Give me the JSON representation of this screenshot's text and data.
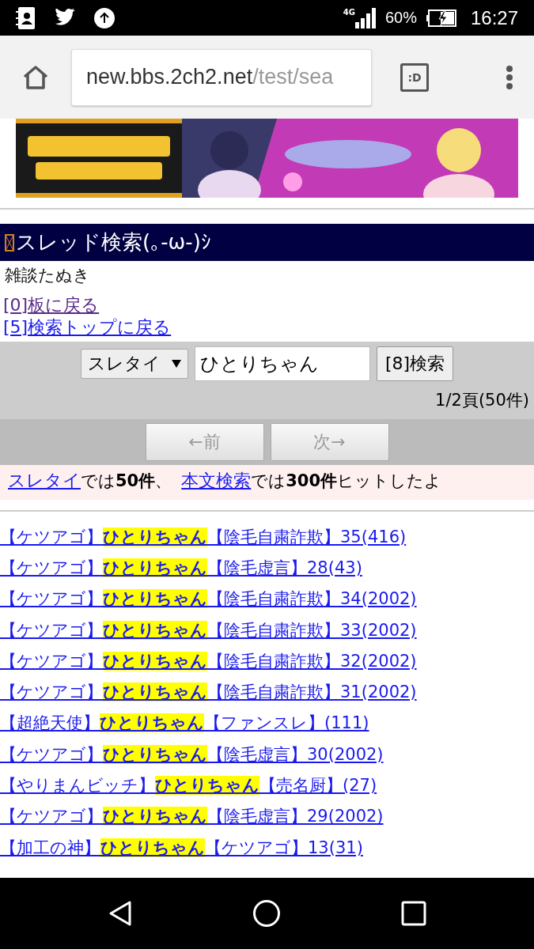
{
  "status_bar": {
    "network": "4G",
    "battery": "60%",
    "time": "16:27"
  },
  "browser": {
    "url_host": "new.bbs.2ch2.net",
    "url_path": "/test/sea",
    "tab_button": ":D"
  },
  "page": {
    "title": "スレッド検索(｡-ω-)ｼ",
    "board": "雑談たぬき",
    "nav_links": [
      {
        "label": "[0]板に戻る",
        "visited": true
      },
      {
        "label": "[5]検索トップに戻る",
        "visited": false
      }
    ]
  },
  "search": {
    "mode": "スレタイ",
    "query": "ひとりちゃん",
    "button": "[8]検索",
    "page_info": "1/2頁(50件)",
    "pager": [
      {
        "label": "←前",
        "disabled": true
      },
      {
        "label": "次→",
        "disabled": true
      }
    ]
  },
  "summary": [
    {
      "kind": "link",
      "text": "スレタイ"
    },
    {
      "kind": "text",
      "text": "では**50件**、"
    },
    {
      "kind": "link",
      "text": "本文検索"
    },
    {
      "kind": "text",
      "text": "では**300件**ヒットしたよ"
    }
  ],
  "results": [
    {
      "prefix": "【ケツアゴ】",
      "keyword": "ひとりちゃん",
      "suffix": "【陰毛自粛詐欺】35(416)"
    },
    {
      "prefix": "【ケツアゴ】",
      "keyword": "ひとりちゃん",
      "suffix": "【陰毛虚言】28(43)"
    },
    {
      "prefix": "【ケツアゴ】",
      "keyword": "ひとりちゃん",
      "suffix": "【陰毛自粛詐欺】34(2002)"
    },
    {
      "prefix": "【ケツアゴ】",
      "keyword": "ひとりちゃん",
      "suffix": "【陰毛自粛詐欺】33(2002)"
    },
    {
      "prefix": "【ケツアゴ】",
      "keyword": "ひとりちゃん",
      "suffix": "【陰毛自粛詐欺】32(2002)"
    },
    {
      "prefix": "【ケツアゴ】",
      "keyword": "ひとりちゃん",
      "suffix": "【陰毛自粛詐欺】31(2002)"
    },
    {
      "prefix": "【超絶天使】",
      "keyword": "ひとりちゃん",
      "suffix": "【ファンスレ】(111)"
    },
    {
      "prefix": "【ケツアゴ】",
      "keyword": "ひとりちゃん",
      "suffix": "【陰毛虚言】30(2002)"
    },
    {
      "prefix": "【やりまんビッチ】",
      "keyword": "ひとりちゃん",
      "suffix": "【売名厨】(27)"
    },
    {
      "prefix": "【ケツアゴ】",
      "keyword": "ひとりちゃん",
      "suffix": "【陰毛虚言】29(2002)"
    },
    {
      "prefix": "【加工の神】",
      "keyword": "ひとりちゃん",
      "suffix": "【ケツアゴ】13(31)"
    }
  ]
}
